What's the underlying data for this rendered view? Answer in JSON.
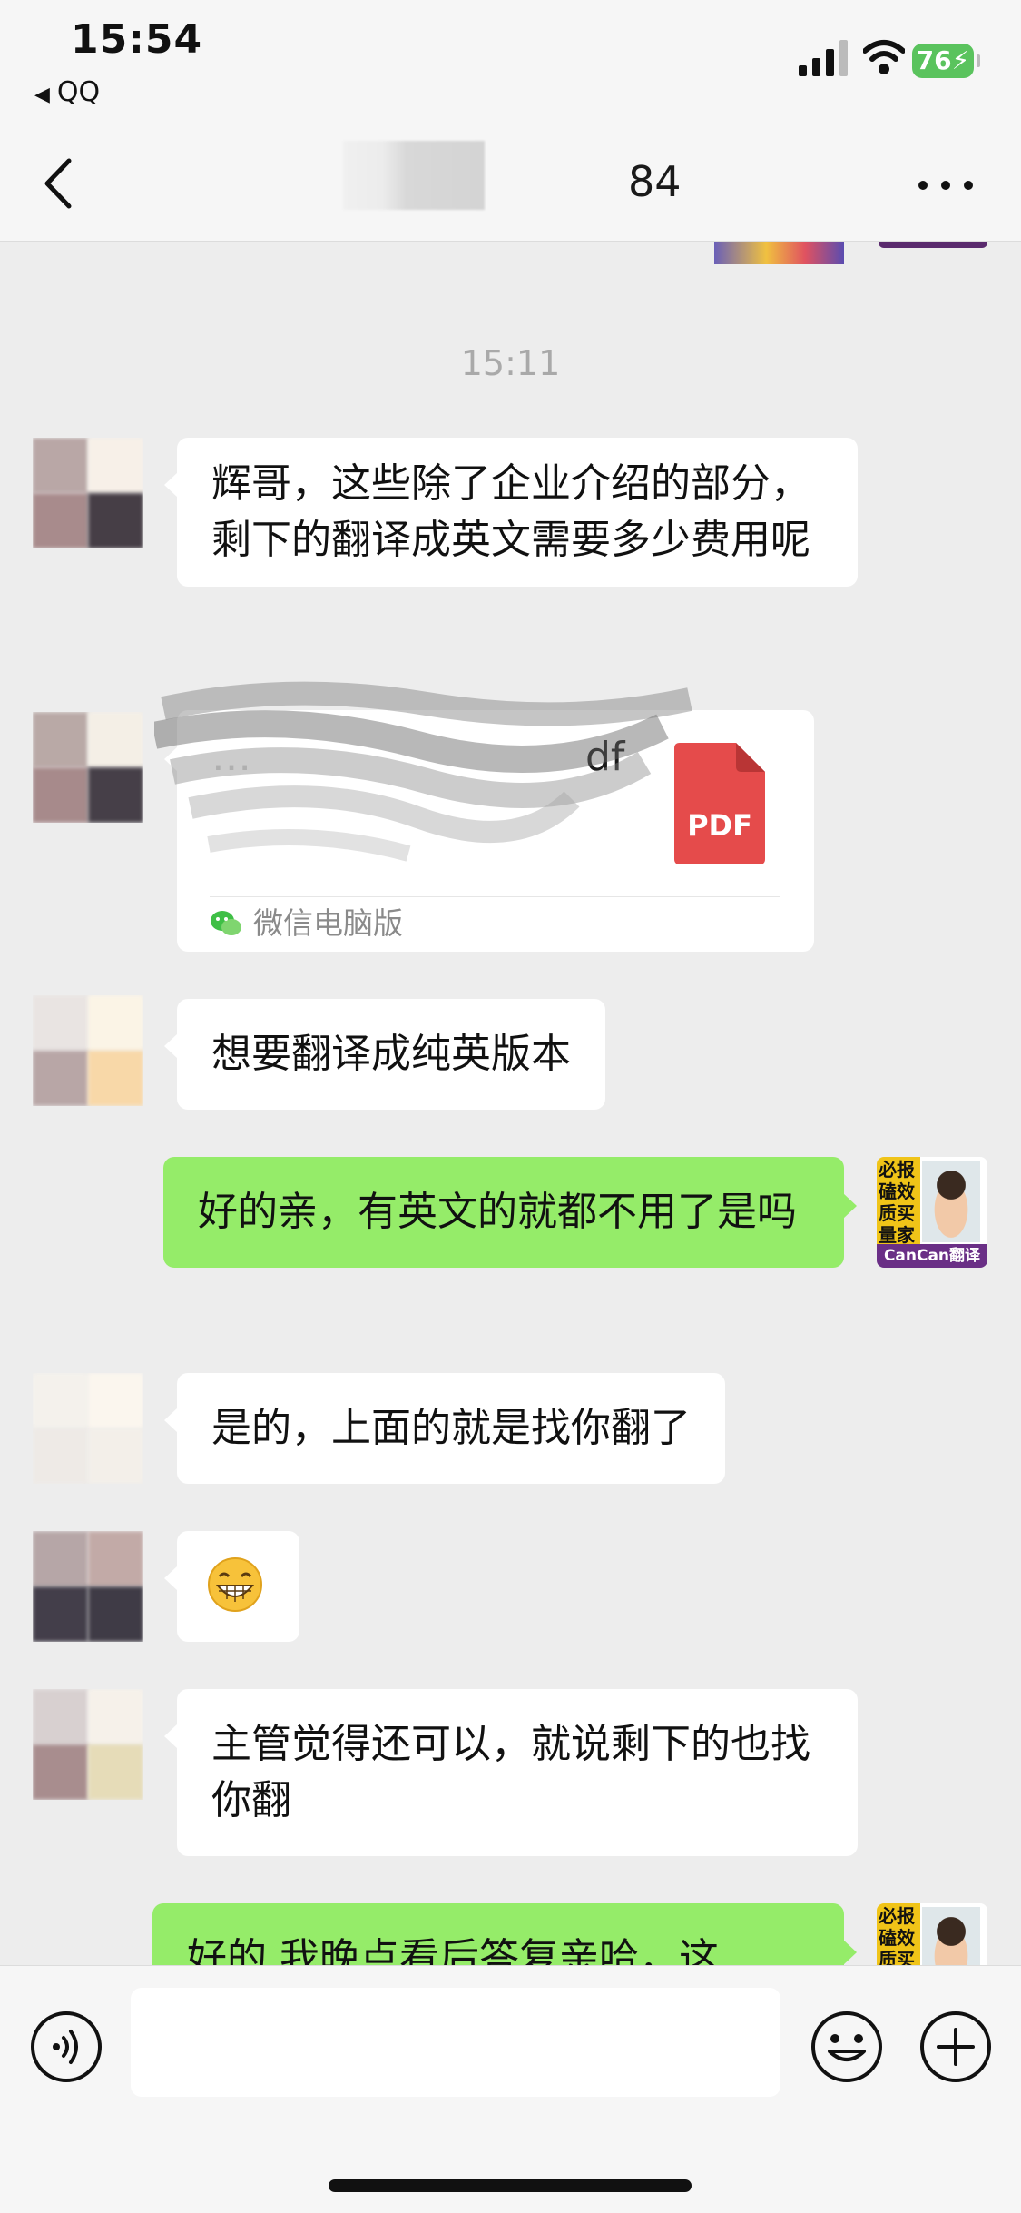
{
  "status_bar": {
    "time": "15:54",
    "back_app": "QQ",
    "battery": "76"
  },
  "nav": {
    "title_visible": "84"
  },
  "chat": {
    "timestamp": "15:11",
    "msg1": "辉哥，这些除了企业介绍的部分，剩下的翻译成英文需要多少费用呢",
    "file": {
      "name_tail": "df",
      "size": "",
      "icon_label": "PDF",
      "source": "微信电脑版"
    },
    "msg2": "想要翻译成纯英版本",
    "msg3": "好的亲，有英文的就都不用了是吗",
    "msg4": "是的，上面的就是找你翻了",
    "msg5_emoji": "grin-emoji",
    "msg6": "主管觉得还可以，就说剩下的也找你翻",
    "msg7": "好的 我晚点看后答复亲哈，这"
  },
  "avatar_cancan": {
    "tag_chars": [
      "必",
      "报",
      "磕",
      "效",
      "质",
      "买",
      "量",
      "家"
    ],
    "brand": "CanCan翻译"
  },
  "icons": {
    "back": "back-arrow-icon",
    "more": "more-dots-icon",
    "voice": "voice-icon",
    "emoji": "emoji-icon",
    "plus": "plus-icon",
    "pdf": "pdf-icon",
    "wechat": "wechat-icon"
  },
  "colors": {
    "outgoing_bubble": "#95ec69",
    "incoming_bubble": "#ffffff",
    "background": "#ededed",
    "pdf_red": "#e54b4b"
  }
}
